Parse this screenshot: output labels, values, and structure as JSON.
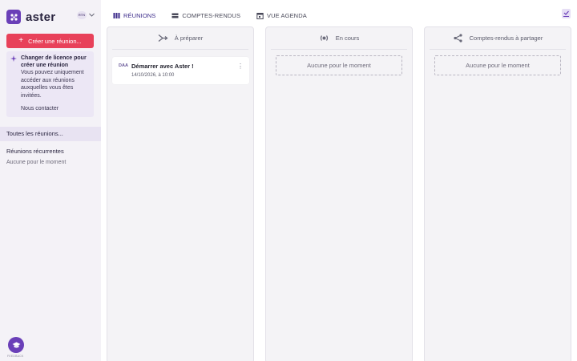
{
  "app": {
    "name": "aster",
    "user_initials": "RTN"
  },
  "sidebar": {
    "create_label": "Créer une réunion...",
    "license": {
      "title": "Changer de licence pour créer une réunion",
      "text": "Vous pouvez uniquement accéder aux réunions auxquelles vous êtes invitées.",
      "link": "Nous contacter"
    },
    "all_meetings": "Toutes les réunions...",
    "recurring_title": "Réunions récurrentes",
    "recurring_empty": "Aucune pour le moment",
    "help_caption": "FEEDBACK"
  },
  "tabs": [
    {
      "label": "RÉUNIONS",
      "icon": "columns-icon",
      "active": true
    },
    {
      "label": "COMPTES-RENDUS",
      "icon": "list-icon",
      "active": false
    },
    {
      "label": "VUE AGENDA",
      "icon": "calendar-icon",
      "active": false
    }
  ],
  "columns": [
    {
      "title": "À préparer",
      "icon": "split-arrow-icon"
    },
    {
      "title": "En cours",
      "icon": "broadcast-icon",
      "empty": "Aucune pour le moment"
    },
    {
      "title": "Comptes-rendus à partager",
      "icon": "share-icon",
      "empty": "Aucune pour le moment"
    }
  ],
  "card": {
    "badge": "DAA",
    "title": "Démarrer avec Aster !",
    "date": "14/10/2026, à 10:00"
  },
  "colors": {
    "brand": "#6a3fb8",
    "create_button": "#e8415a",
    "active_tab": "#3b2a8a",
    "sidebar_bg": "#f4f2f7",
    "license_bg": "#ece7f5"
  }
}
